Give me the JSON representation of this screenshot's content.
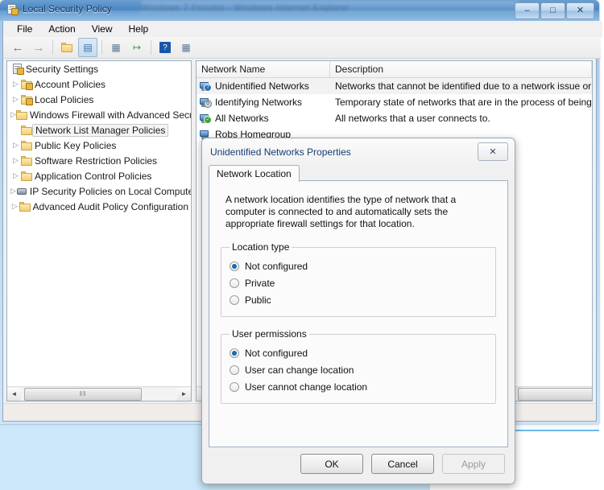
{
  "window": {
    "title": "Local Security Policy",
    "title_icon": "security-policy-icon",
    "ghost_text": "Windows 7 Forums - Windows Internet Explorer",
    "controls": {
      "minimize": "–",
      "maximize": "□",
      "close": "✕"
    }
  },
  "menubar": {
    "items": [
      {
        "label": "File"
      },
      {
        "label": "Action"
      },
      {
        "label": "View"
      },
      {
        "label": "Help"
      }
    ]
  },
  "toolbar": {
    "buttons": [
      {
        "name": "back-icon",
        "glyph": "←",
        "color": "#2f7cc4",
        "pressed": false
      },
      {
        "name": "forward-icon",
        "glyph": "→",
        "color": "#9aa3ab",
        "pressed": false
      },
      {
        "name": "up-folder-icon",
        "glyph": "🗁",
        "color": "#c79a3c",
        "pressed": false
      },
      {
        "name": "show-tree-icon",
        "glyph": "▤",
        "color": "#3b6ea5",
        "pressed": true
      },
      {
        "name": "properties-icon",
        "glyph": "▥",
        "color": "#5d7a96",
        "pressed": false
      },
      {
        "name": "export-list-icon",
        "glyph": "↦",
        "color": "#3f9b3f",
        "pressed": false
      },
      {
        "name": "help-icon",
        "glyph": "?",
        "color": "#1a56a8",
        "pressed": false
      },
      {
        "name": "view-pane-icon",
        "glyph": "▦",
        "color": "#5d7a96",
        "pressed": false
      }
    ]
  },
  "tree": {
    "root": {
      "label": "Security Settings",
      "icon": "security-settings-icon"
    },
    "items": [
      {
        "label": "Account Policies",
        "icon": "folder-lock-icon",
        "expandable": true,
        "selected": false
      },
      {
        "label": "Local Policies",
        "icon": "folder-lock-icon",
        "expandable": true,
        "selected": false
      },
      {
        "label": "Windows Firewall with Advanced Security",
        "icon": "folder-icon",
        "expandable": true,
        "selected": false
      },
      {
        "label": "Network List Manager Policies",
        "icon": "folder-icon",
        "expandable": false,
        "selected": true
      },
      {
        "label": "Public Key Policies",
        "icon": "folder-icon",
        "expandable": true,
        "selected": false
      },
      {
        "label": "Software Restriction Policies",
        "icon": "folder-icon",
        "expandable": true,
        "selected": false
      },
      {
        "label": "Application Control Policies",
        "icon": "folder-icon",
        "expandable": true,
        "selected": false
      },
      {
        "label": "IP Security Policies on Local Computer",
        "icon": "server-icon",
        "expandable": true,
        "selected": false
      },
      {
        "label": "Advanced Audit Policy Configuration",
        "icon": "folder-icon",
        "expandable": true,
        "selected": false
      }
    ]
  },
  "list": {
    "columns": [
      {
        "label": "Network Name"
      },
      {
        "label": "Description"
      }
    ],
    "rows": [
      {
        "name": "Unidentified Networks",
        "description": "Networks that cannot be identified due to a network issue or lack of",
        "icon": "network-unidentified-icon",
        "badge": "?",
        "selected": true
      },
      {
        "name": "Identifying Networks",
        "description": "Temporary state of networks that are in the process of being identi",
        "icon": "network-identifying-icon",
        "badge": "◔",
        "selected": false
      },
      {
        "name": "All Networks",
        "description": "All networks that a user connects to.",
        "icon": "network-all-icon",
        "badge": "✓",
        "selected": false
      },
      {
        "name": "Robs Homegroup",
        "description": "",
        "icon": "network-icon",
        "badge": "",
        "selected": false
      }
    ]
  },
  "scrollbars": {
    "left_arrow": "◄",
    "right_arrow": "►",
    "grip": "‖‖"
  },
  "dialog": {
    "title": "Unidentified Networks Properties",
    "close_glyph": "✕",
    "tabs": [
      {
        "label": "Network Location",
        "active": true
      }
    ],
    "description": "A network location identifies the type of network that a computer is connected to and automatically sets the appropriate firewall settings for that location.",
    "groups": [
      {
        "legend": "Location type",
        "name": "location-type",
        "options": [
          {
            "label": "Not configured",
            "selected": true
          },
          {
            "label": "Private",
            "selected": false
          },
          {
            "label": "Public",
            "selected": false
          }
        ]
      },
      {
        "legend": "User permissions",
        "name": "user-permissions",
        "options": [
          {
            "label": "Not configured",
            "selected": true
          },
          {
            "label": "User can change location",
            "selected": false
          },
          {
            "label": "User cannot change location",
            "selected": false
          }
        ]
      }
    ],
    "buttons": [
      {
        "label": "OK",
        "name": "ok-button",
        "enabled": true
      },
      {
        "label": "Cancel",
        "name": "cancel-button",
        "enabled": true
      },
      {
        "label": "Apply",
        "name": "apply-button",
        "enabled": false
      }
    ]
  },
  "colors": {
    "titlebar_accent": "#4c86c4",
    "radio_accent": "#1769b5",
    "dialog_title_text": "#143c73",
    "selection": "#f2f2f2",
    "background_panel": "#cbe7f9"
  }
}
